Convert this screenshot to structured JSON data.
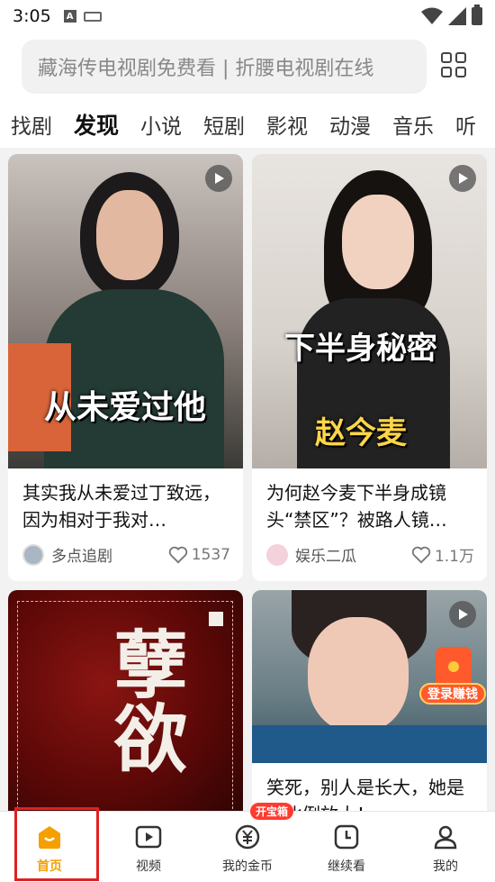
{
  "status": {
    "time": "3:05"
  },
  "search": {
    "placeholder": "藏海传电视剧免费看 | 折腰电视剧在线"
  },
  "tabs": [
    {
      "label": "找剧"
    },
    {
      "label": "发现"
    },
    {
      "label": "小说"
    },
    {
      "label": "短剧"
    },
    {
      "label": "影视"
    },
    {
      "label": "动漫"
    },
    {
      "label": "音乐"
    },
    {
      "label": "听"
    }
  ],
  "cards": [
    {
      "title": "其实我从未爱过丁致远，因为相对于我对…",
      "overlay": "从未爱过他",
      "author": "多点追剧",
      "likes": "1537"
    },
    {
      "title": "为何赵今麦下半身成镜头“禁区”？被路人镜…",
      "overlay_top": "下半身秘密",
      "overlay_bottom": "赵今麦",
      "author": "娱乐二瓜",
      "likes": "1.1万"
    },
    {
      "title": "",
      "poster_text": "孽欲"
    },
    {
      "title": "笑死，别人是长大，她是等比例放大！"
    }
  ],
  "float_badge": {
    "label": "登录赚钱"
  },
  "bottom_nav": [
    {
      "label": "首页"
    },
    {
      "label": "视频"
    },
    {
      "label": "我的金币",
      "badge": "开宝箱"
    },
    {
      "label": "继续看"
    },
    {
      "label": "我的"
    }
  ],
  "colors": {
    "accent": "#f5b800",
    "nav_active": "#f5a000",
    "highlight": "#e02020"
  }
}
